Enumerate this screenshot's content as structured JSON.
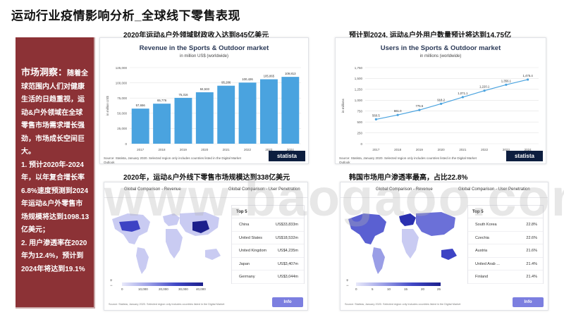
{
  "page_title": "运动行业疫情影响分析_全球线下零售表现",
  "side": {
    "head": "市场洞察：",
    "text": "随着全球范围内人们对健康生活的日趋重视，运动&户外领域在全球零售市场需求增长强劲，市场成长空间巨大。",
    "point1": "1. 预计2020年-2024年，以年复合增长率6.8%速度预测到2024年运动&户外零售市场规模将达到1098.13亿美元；",
    "point2": "2. 用户渗透率在2020年为12.4%，预计到2024年将达到19.1%"
  },
  "captions": {
    "revenue": "2020年运动&户外领域财政收入达到845亿美元",
    "users": "预计到2024, 运动&户外用户数量预计将达到14.75亿",
    "comparison_revenue": "2020年，运动&户外线下零售市场规模达到338亿美元",
    "comparison_penetration": "韩国市场用户渗透率最高，占比22.8%"
  },
  "revenue_chart": {
    "title": "Revenue in the Sports & Outdoor market",
    "subtitle": "in million US$ (worldwide)",
    "source": "Source: Statista, January 2020. Selected region only includes countries listed in the Digital Market Outlook",
    "brand": "statista",
    "chart_data": {
      "type": "bar",
      "categories": [
        "2017",
        "2018",
        "2019",
        "2020",
        "2021",
        "2022",
        "2023",
        "2024"
      ],
      "values": [
        57656,
        65776,
        75316,
        84533,
        95286,
        100426,
        105865,
        109813
      ],
      "value_labels": [
        "57,656",
        "65,776",
        "75,316",
        "84,533",
        "95,286",
        "100,426",
        "105,865",
        "109,813"
      ],
      "ylabel": "in million US$",
      "ylim": [
        0,
        125000
      ],
      "yticks": [
        "0",
        "25,000",
        "50,000",
        "75,000",
        "100,000",
        "125,000"
      ],
      "color": "#4aa3df"
    }
  },
  "users_chart": {
    "title": "Users in the Sports & Outdoor market",
    "subtitle": "in millions (worldwide)",
    "source": "Source: Statista, January 2020. Selected region only includes countries listed in the Digital Market Outlook",
    "brand": "statista",
    "chart_data": {
      "type": "line",
      "categories": [
        "2017",
        "2018",
        "2019",
        "2020",
        "2021",
        "2022",
        "2023",
        "2024"
      ],
      "values": [
        560.5,
        661.0,
        775.5,
        918.2,
        1071.1,
        1220.1,
        1356.1,
        1475.4
      ],
      "value_labels": [
        "560.5",
        "661.0",
        "775.5",
        "918.2",
        "1,071.1",
        "1,220.1",
        "1,356.1",
        "1,475.4"
      ],
      "ylabel": "in millions",
      "ylim": [
        0,
        1750
      ],
      "yticks": [
        "0",
        "250",
        "500",
        "750",
        "1,000",
        "1,250",
        "1,500",
        "1,750"
      ],
      "color": "#4aa3df"
    }
  },
  "comparison_revenue": {
    "tab_left": "Global Comparison - Revenue",
    "tab_right": "Global Comparison - User Penetration",
    "top5_title": "Top 5",
    "rows": [
      {
        "country": "China",
        "value": "US$33,833m"
      },
      {
        "country": "United States",
        "value": "US$18,532m"
      },
      {
        "country": "United Kingdom",
        "value": "US$4,235m"
      },
      {
        "country": "Japan",
        "value": "US$3,407m"
      },
      {
        "country": "Germany",
        "value": "US$3,044m"
      }
    ],
    "legend_ticks": [
      "0",
      "10,000",
      "20,000",
      "30,000",
      "40,000"
    ],
    "zoom_in": "+",
    "zoom_out": "−",
    "info": "Info",
    "footnote": "Source: Statista, January 2020. Selected region only includes countries listed in the Digital Market"
  },
  "comparison_penetration": {
    "tab_left": "Global Comparison - Revenue",
    "tab_right": "Global Comparison - User Penetration",
    "top5_title": "Top 5",
    "rows": [
      {
        "country": "South Korea",
        "value": "22.8%"
      },
      {
        "country": "Czechia",
        "value": "22.6%"
      },
      {
        "country": "Austria",
        "value": "21.6%"
      },
      {
        "country": "United Arab ...",
        "value": "21.4%"
      },
      {
        "country": "Finland",
        "value": "21.4%"
      }
    ],
    "legend_ticks": [
      "0",
      "5",
      "10",
      "15",
      "20",
      "25"
    ],
    "zoom_in": "+",
    "zoom_out": "−",
    "info": "Info",
    "footnote": "Source: Statista, January 2020. Selected region only includes countries listed in the Digital Market"
  },
  "watermark": "www.baogaoo.com"
}
